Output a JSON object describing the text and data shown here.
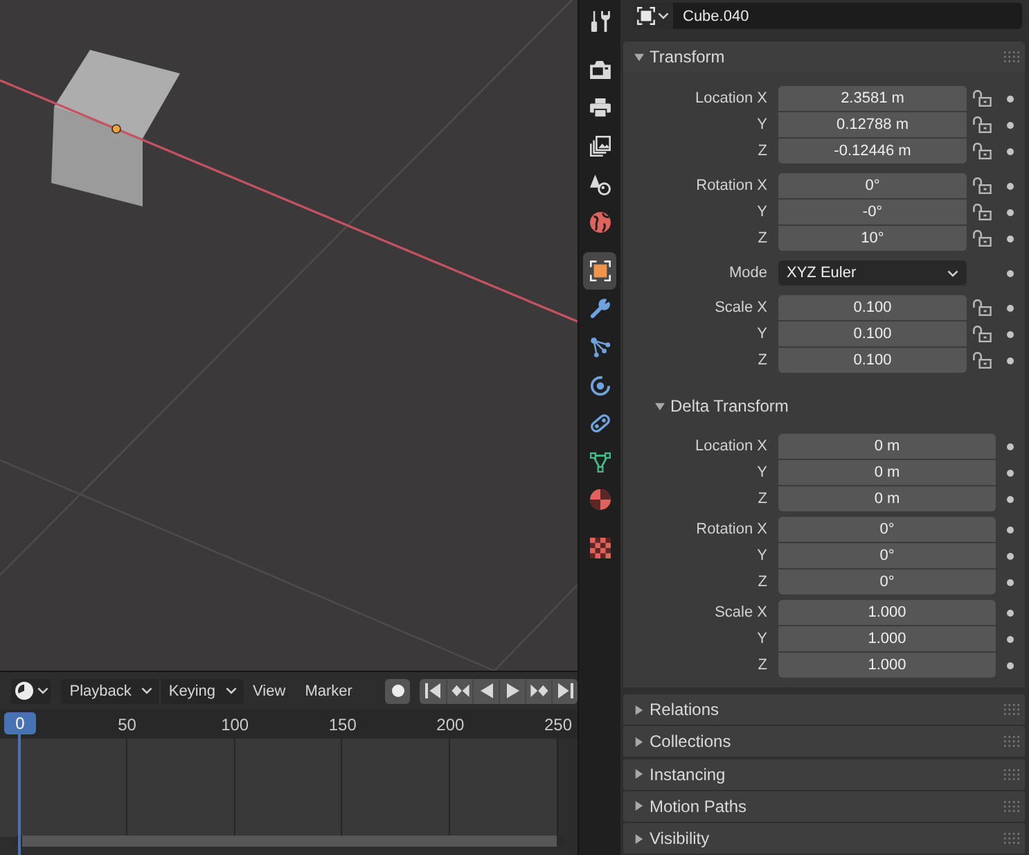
{
  "properties": {
    "tab_groups": [
      {
        "tabs": [
          {
            "kind": "tool",
            "selected": false
          }
        ]
      },
      {
        "tabs": [
          {
            "kind": "render",
            "selected": false
          },
          {
            "kind": "output",
            "selected": false
          },
          {
            "kind": "view_layer",
            "selected": false
          },
          {
            "kind": "scene",
            "selected": false
          },
          {
            "kind": "world",
            "selected": false
          }
        ]
      },
      {
        "tabs": [
          {
            "kind": "object",
            "selected": true
          },
          {
            "kind": "modifiers",
            "selected": false
          },
          {
            "kind": "particles",
            "selected": false
          },
          {
            "kind": "physics",
            "selected": false
          },
          {
            "kind": "constraints",
            "selected": false
          },
          {
            "kind": "data",
            "selected": false
          },
          {
            "kind": "material",
            "selected": false
          }
        ]
      },
      {
        "tabs": [
          {
            "kind": "texture",
            "selected": false
          }
        ]
      }
    ],
    "object_name": "Cube.040",
    "panels": [
      {
        "title": "Transform",
        "expanded": true,
        "groups": [
          {
            "rows": [
              {
                "kind": "number",
                "label": "Location X",
                "value": "2.3581 m",
                "locked": false
              },
              {
                "kind": "number",
                "label": "Y",
                "value": "0.12788 m",
                "locked": false
              },
              {
                "kind": "number",
                "label": "Z",
                "value": "-0.12446 m",
                "locked": false
              }
            ]
          },
          {
            "rows": [
              {
                "kind": "number",
                "label": "Rotation X",
                "value": "0°",
                "locked": false
              },
              {
                "kind": "number",
                "label": "Y",
                "value": "-0°",
                "locked": false
              },
              {
                "kind": "number",
                "label": "Z",
                "value": "10°",
                "locked": false
              }
            ]
          },
          {
            "rows": [
              {
                "kind": "dropdown",
                "label": "Mode",
                "value": "XYZ Euler"
              }
            ]
          },
          {
            "rows": [
              {
                "kind": "number",
                "label": "Scale X",
                "value": "0.100",
                "locked": false
              },
              {
                "kind": "number",
                "label": "Y",
                "value": "0.100",
                "locked": false
              },
              {
                "kind": "number",
                "label": "Z",
                "value": "0.100",
                "locked": false
              }
            ]
          }
        ],
        "subpanels": [
          {
            "title": "Delta Transform",
            "expanded": true,
            "groups": [
              {
                "rows": [
                  {
                    "kind": "number",
                    "label": "Location X",
                    "value": "0 m"
                  },
                  {
                    "kind": "number",
                    "label": "Y",
                    "value": "0 m"
                  },
                  {
                    "kind": "number",
                    "label": "Z",
                    "value": "0 m"
                  }
                ]
              },
              {
                "rows": [
                  {
                    "kind": "number",
                    "label": "Rotation X",
                    "value": "0°"
                  },
                  {
                    "kind": "number",
                    "label": "Y",
                    "value": "0°"
                  },
                  {
                    "kind": "number",
                    "label": "Z",
                    "value": "0°"
                  }
                ]
              },
              {
                "rows": [
                  {
                    "kind": "number",
                    "label": "Scale X",
                    "value": "1.000"
                  },
                  {
                    "kind": "number",
                    "label": "Y",
                    "value": "1.000"
                  },
                  {
                    "kind": "number",
                    "label": "Z",
                    "value": "1.000"
                  }
                ]
              }
            ]
          }
        ]
      },
      {
        "title": "Relations",
        "expanded": false
      },
      {
        "title": "Collections",
        "expanded": false
      },
      {
        "title": "Instancing",
        "expanded": false
      },
      {
        "title": "Motion Paths",
        "expanded": false
      },
      {
        "title": "Visibility",
        "expanded": false
      }
    ]
  },
  "timeline": {
    "menus": [
      {
        "label": "Playback",
        "kind": "dropdown"
      },
      {
        "label": "Keying",
        "kind": "dropdown"
      },
      {
        "label": "View",
        "kind": "menu"
      },
      {
        "label": "Marker",
        "kind": "menu"
      }
    ],
    "current_frame": "0",
    "frame_ticks": [
      "50",
      "100",
      "150",
      "200",
      "250"
    ]
  }
}
